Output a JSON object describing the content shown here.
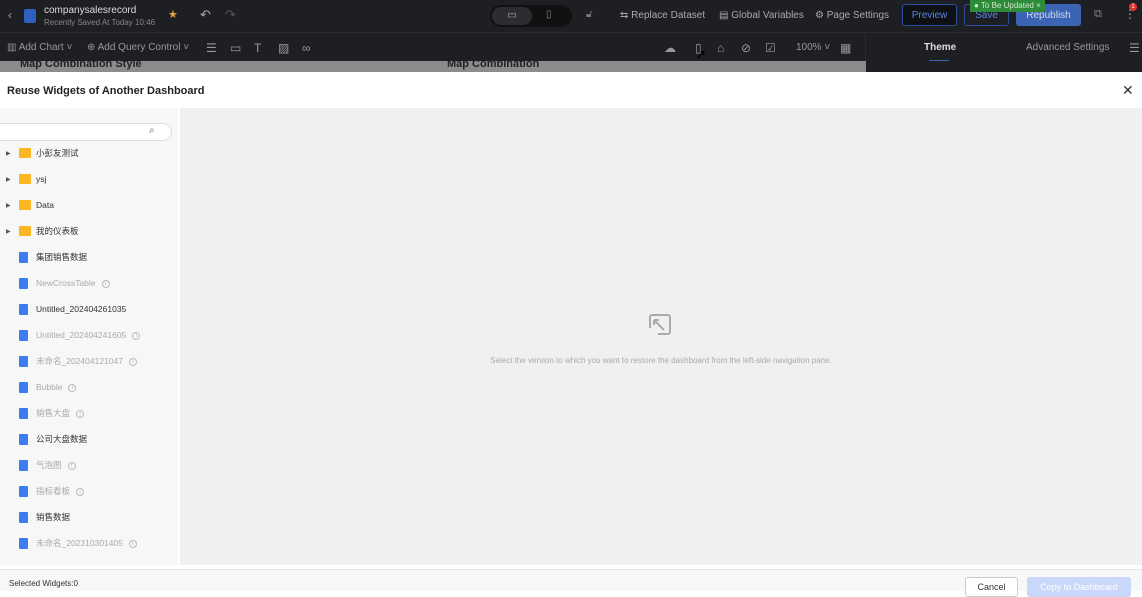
{
  "header": {
    "title": "companysalesrecord",
    "saved": "Recently Saved At Today 10:46",
    "replace_dataset": "Replace Dataset",
    "global_variables": "Global Variables",
    "page_settings": "Page Settings",
    "preview": "Preview",
    "save": "Save",
    "republish": "Republish",
    "toast": "To Be Updated",
    "badge": "1"
  },
  "toolbar": {
    "add_chart": "Add Chart",
    "add_query": "Add Query Control",
    "zoom": "100%",
    "tab_theme": "Theme",
    "tab_advanced": "Advanced Settings"
  },
  "canvas": {
    "title1": "Map Combination Style",
    "title2": "Map Combination"
  },
  "modal": {
    "title": "Reuse Widgets of Another Dashboard",
    "search_placeholder": "",
    "tree": [
      {
        "label": "小彭友测试",
        "type": "folder",
        "disabled": false
      },
      {
        "label": "ysj",
        "type": "folder",
        "disabled": false
      },
      {
        "label": "Data",
        "type": "folder",
        "disabled": false
      },
      {
        "label": "我的仪表板",
        "type": "folder",
        "disabled": false
      },
      {
        "label": "集团销售数据",
        "type": "file",
        "disabled": false
      },
      {
        "label": "NewCrossTable",
        "type": "file",
        "disabled": true
      },
      {
        "label": "Untitled_202404261035",
        "type": "file",
        "disabled": false
      },
      {
        "label": "Untitled_202404241605",
        "type": "file",
        "disabled": true
      },
      {
        "label": "未命名_202404121047",
        "type": "file",
        "disabled": true
      },
      {
        "label": "Bubble",
        "type": "file",
        "disabled": true
      },
      {
        "label": "销售大盘",
        "type": "file",
        "disabled": true
      },
      {
        "label": "公司大盘数据",
        "type": "file",
        "disabled": false
      },
      {
        "label": "气泡图",
        "type": "file",
        "disabled": true
      },
      {
        "label": "指标看板",
        "type": "file",
        "disabled": true
      },
      {
        "label": "销售数据",
        "type": "file",
        "disabled": false
      },
      {
        "label": "未命名_202310301405",
        "type": "file",
        "disabled": true
      }
    ],
    "empty_text": "Select the version to which you want to restore the dashboard from the left-side navigation pane.",
    "selected": "Selected Widgets:0",
    "cancel": "Cancel",
    "copy": "Copy to Dashboard"
  }
}
